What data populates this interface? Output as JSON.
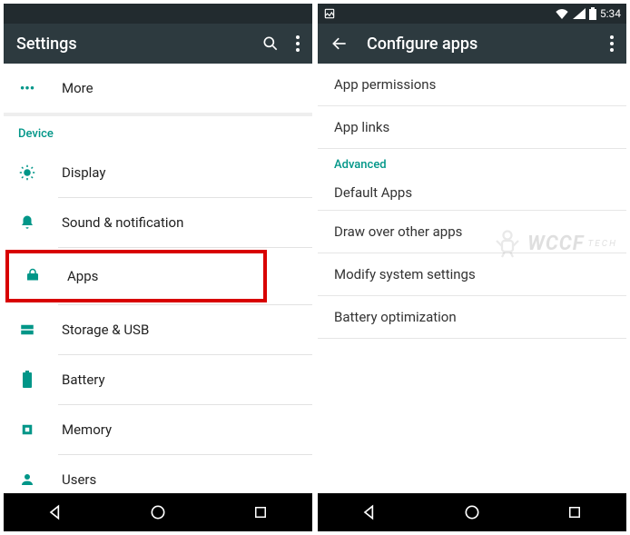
{
  "left": {
    "title": "Settings",
    "more_label": "More",
    "device_header": "Device",
    "items": {
      "display": "Display",
      "sound": "Sound & notification",
      "apps": "Apps",
      "storage": "Storage & USB",
      "battery": "Battery",
      "memory": "Memory",
      "users": "Users"
    }
  },
  "right": {
    "title": "Configure apps",
    "status_time": "5:34",
    "items": {
      "perms": "App permissions",
      "links": "App links",
      "adv_header": "Advanced",
      "default": "Default Apps",
      "draw": "Draw over other apps",
      "modify": "Modify system settings",
      "battopt": "Battery optimization"
    }
  },
  "watermark": {
    "main": "WCCF",
    "sub": "TECH"
  }
}
